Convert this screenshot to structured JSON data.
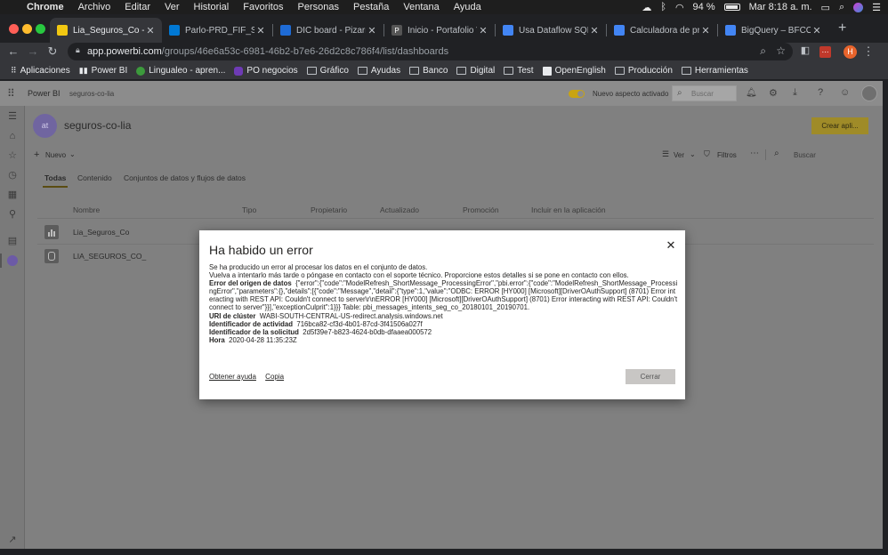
{
  "menubar": {
    "app": "Chrome",
    "items": [
      "Archivo",
      "Editar",
      "Ver",
      "Historial",
      "Favoritos",
      "Personas",
      "Pestaña",
      "Ventana",
      "Ayuda"
    ],
    "battery": "94 %",
    "clock": "Mar 8:18 a. m."
  },
  "tabs": [
    {
      "title": "Lia_Seguros_Co - Po",
      "color": "#f2c811",
      "icon": "powerbi-icon"
    },
    {
      "title": "Parlo-PRD_FIF_SP | U",
      "color": "#0078d4",
      "icon": "azure-icon"
    },
    {
      "title": "DIC board - Pizarra A",
      "color": "#1e6bd6",
      "icon": "board-icon"
    },
    {
      "title": "Inicio - Portafolio Ve",
      "color": "#555555",
      "icon": "portfolio-icon"
    },
    {
      "title": "Usa Dataflow SQL",
      "color": "#4285f4",
      "icon": "gcloud-icon"
    },
    {
      "title": "Calculadora de prec",
      "color": "#4285f4",
      "icon": "gcloud-icon"
    },
    {
      "title": "BigQuery – BFCO-Pr",
      "color": "#4285f4",
      "icon": "bigquery-icon"
    }
  ],
  "omnibox": {
    "host": "app.powerbi.com",
    "path": "/groups/46e6a53c-6981-46b2-b7e6-26d2c8c786f4/list/dashboards"
  },
  "profile_initial": "H",
  "bookmarks": [
    {
      "label": "Aplicaciones",
      "icon": "apps-grid-icon"
    },
    {
      "label": "Power BI",
      "icon": "powerbi-icon"
    },
    {
      "label": "Lingualeo - apren...",
      "icon": "lingualeo-icon"
    },
    {
      "label": "PO negocios",
      "icon": "po-icon"
    },
    {
      "label": "Gráfico",
      "icon": "folder-icon"
    },
    {
      "label": "Ayudas",
      "icon": "folder-icon"
    },
    {
      "label": "Banco",
      "icon": "folder-icon"
    },
    {
      "label": "Digital",
      "icon": "folder-icon"
    },
    {
      "label": "Test",
      "icon": "folder-icon"
    },
    {
      "label": "OpenEnglish",
      "icon": "openenglish-icon"
    },
    {
      "label": "Producción",
      "icon": "folder-icon"
    },
    {
      "label": "Herramientas",
      "icon": "folder-icon"
    }
  ],
  "app": {
    "brand": "Power BI",
    "workspace_crumb": "seguros-co-lia",
    "new_look_label": "Nuevo aspecto activado",
    "search_placeholder": "Buscar"
  },
  "workspace": {
    "avatar": "at",
    "name": "seguros-co-lia",
    "create_app": "Crear apli...",
    "new_label": "Nuevo",
    "view_label": "Ver",
    "filters_label": "Filtros",
    "search_placeholder": "Buscar",
    "tabs": [
      "Todas",
      "Contenido",
      "Conjuntos de datos y flujos de datos"
    ],
    "columns": [
      "Nombre",
      "Tipo",
      "Propietario",
      "Actualizado",
      "Promoción",
      "Incluir en la aplicación"
    ],
    "rows": [
      {
        "name": "Lia_Seguros_Co",
        "icon": "report-icon"
      },
      {
        "name": "LIA_SEGUROS_CO_",
        "icon": "dataset-icon"
      }
    ]
  },
  "dialog": {
    "title": "Ha habido un error",
    "intro1": "Se ha producido un error al procesar los datos en el conjunto de datos.",
    "intro2": "Vuelva a intentarlo más tarde o póngase en contacto con el soporte técnico. Proporcione estos detalles si se pone en contacto con ellos.",
    "source_label": "Error del origen de datos",
    "source_value": "{\"error\":{\"code\":\"ModelRefresh_ShortMessage_ProcessingError\",\"pbi.error\":{\"code\":\"ModelRefresh_ShortMessage_ProcessingError\",\"parameters\":{},\"details\":[{\"code\":\"Message\",\"detail\":{\"type\":1,\"value\":\"ODBC: ERROR [HY000] [Microsoft][DriverOAuthSupport] (8701) Error interacting with REST API: Couldn't connect to server\\r\\nERROR [HY000] [Microsoft][DriverOAuthSupport] (8701) Error interacting with REST API: Couldn't connect to server\"}}],\"exceptionCulprit\":1}}} Table: pbi_messages_intents_seg_co_20180101_20190701.",
    "cluster_label": "URI de clúster",
    "cluster_value": "WABI-SOUTH-CENTRAL-US-redirect.analysis.windows.net",
    "activity_label": "Identificador de actividad",
    "activity_value": "716bca82-cf3d-4b01-87cd-3f41506a027f",
    "request_label": "Identificador de la solicitud",
    "request_value": "2d5f39e7-b823-4624-b0db-dfaaea000572",
    "time_label": "Hora",
    "time_value": "2020-04-28 11:35:23Z",
    "help_link": "Obtener ayuda",
    "copy_link": "Copia",
    "close_button": "Cerrar"
  }
}
